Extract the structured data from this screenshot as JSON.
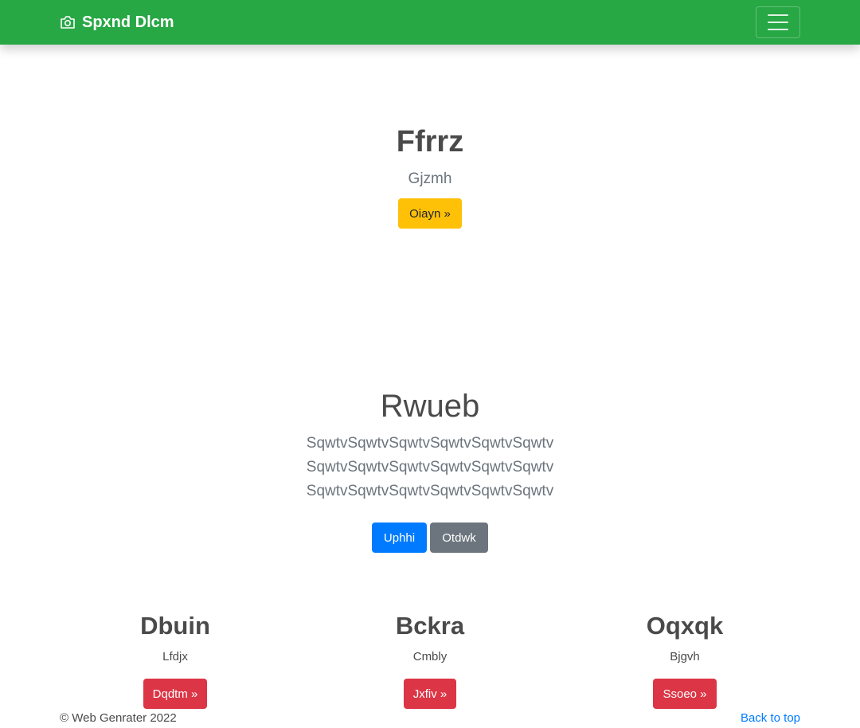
{
  "navbar": {
    "brand": "Spxnd Dlcm",
    "brand_icon": "camera-icon",
    "toggler_icon": "hamburger-menu-icon",
    "color": "#28a745"
  },
  "hero1": {
    "title": "Ffrrz",
    "lead": "Gjzmh",
    "button": "Oiayn »"
  },
  "hero2": {
    "title": "Rwueb",
    "lead": "SqwtvSqwtvSqwtvSqwtvSqwtvSqwtv SqwtvSqwtvSqwtvSqwtvSqwtvSqwtv SqwtvSqwtvSqwtvSqwtvSqwtvSqwtv",
    "primary_button": "Uphhi",
    "secondary_button": "Otdwk"
  },
  "columns": [
    {
      "title": "Dbuin",
      "text": "Lfdjx",
      "button": "Dqdtm »"
    },
    {
      "title": "Bckra",
      "text": "Cmbly",
      "button": "Jxfiv »"
    },
    {
      "title": "Oqxqk",
      "text": "Bjgvh",
      "button": "Ssoeo »"
    }
  ],
  "footer": {
    "copyright": "© Web Genrater 2022",
    "back_to_top": "Back to top"
  },
  "colors": {
    "warning": "#ffc107",
    "primary": "#007bff",
    "secondary": "#6c757d",
    "danger": "#dc3545"
  }
}
